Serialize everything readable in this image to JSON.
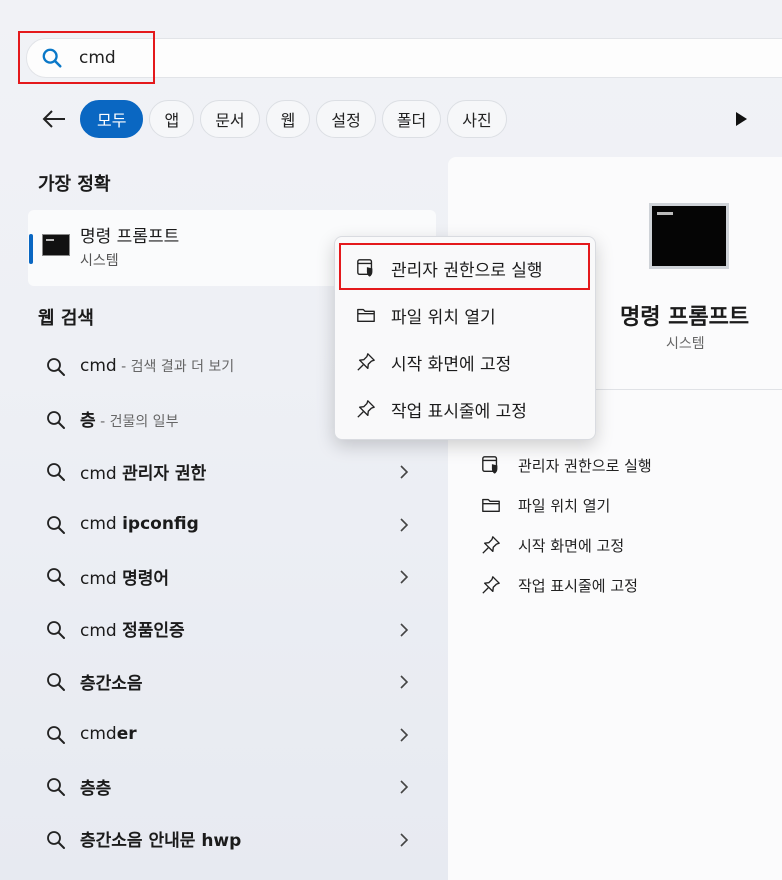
{
  "search": {
    "query": "cmd"
  },
  "filters": {
    "items": [
      {
        "label": "모두",
        "active": true
      },
      {
        "label": "앱",
        "active": false
      },
      {
        "label": "문서",
        "active": false
      },
      {
        "label": "웹",
        "active": false
      },
      {
        "label": "설정",
        "active": false
      },
      {
        "label": "폴더",
        "active": false
      },
      {
        "label": "사진",
        "active": false
      }
    ]
  },
  "best_match": {
    "heading": "가장 정확",
    "name": "명령 프롬프트",
    "type": "시스템"
  },
  "web": {
    "heading": "웹 검색",
    "results": [
      {
        "plain": "cmd",
        "bold": "",
        "hint": " - 검색 결과 더 보기",
        "chevron": false
      },
      {
        "plain": "",
        "bold": "층",
        "hint": " - 건물의 일부",
        "chevron": false
      },
      {
        "plain": "cmd ",
        "bold": "관리자 권한",
        "hint": "",
        "chevron": true
      },
      {
        "plain": "cmd ",
        "bold": "ipconfig",
        "hint": "",
        "chevron": true
      },
      {
        "plain": "cmd ",
        "bold": "명령어",
        "hint": "",
        "chevron": true
      },
      {
        "plain": "cmd ",
        "bold": "정품인증",
        "hint": "",
        "chevron": true
      },
      {
        "plain": "",
        "bold": "층간소음",
        "hint": "",
        "chevron": true
      },
      {
        "plain": "cmd",
        "bold": "er",
        "hint": "",
        "chevron": true
      },
      {
        "plain": "",
        "bold": "층층",
        "hint": "",
        "chevron": true
      },
      {
        "plain": "",
        "bold": "층간소음 안내문 hwp",
        "hint": "",
        "chevron": true
      }
    ]
  },
  "context_menu": {
    "items": [
      {
        "label": "관리자 권한으로 실행",
        "icon": "shield-window-icon"
      },
      {
        "label": "파일 위치 열기",
        "icon": "folder-icon"
      },
      {
        "label": "시작 화면에 고정",
        "icon": "pin-icon"
      },
      {
        "label": "작업 표시줄에 고정",
        "icon": "pin-icon"
      }
    ]
  },
  "preview": {
    "title": "명령 프롬프트",
    "type": "시스템",
    "actions": [
      {
        "label": "관리자 권한으로 실행",
        "icon": "shield-window-icon"
      },
      {
        "label": "파일 위치 열기",
        "icon": "folder-icon"
      },
      {
        "label": "시작 화면에 고정",
        "icon": "pin-icon"
      },
      {
        "label": "작업 표시줄에 고정",
        "icon": "pin-icon"
      }
    ]
  },
  "colors": {
    "accent": "#0a67c2",
    "highlight": "#e4191c"
  }
}
